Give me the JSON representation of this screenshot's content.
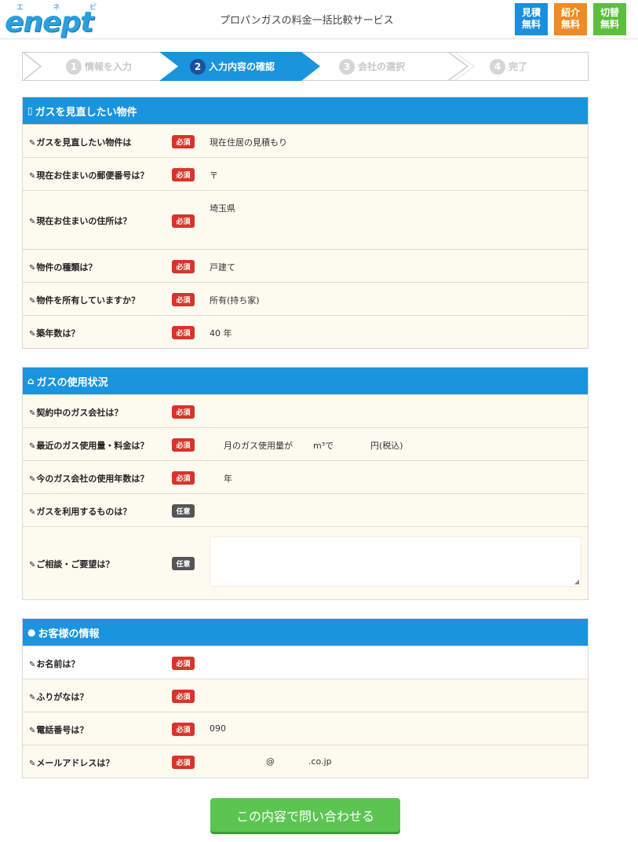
{
  "header": {
    "logo_ruby": [
      "エ",
      "ネ",
      "ピ"
    ],
    "logo_text": "enept",
    "tagline": "プロパンガスの料金一括比較サービス",
    "badges": [
      {
        "line1": "見積",
        "line2": "無料"
      },
      {
        "line1": "紹介",
        "line2": "無料"
      },
      {
        "line1": "切替",
        "line2": "無料"
      }
    ]
  },
  "steps": [
    {
      "num": "1",
      "label": "情報を入力"
    },
    {
      "num": "2",
      "label": "入力内容の確認"
    },
    {
      "num": "3",
      "label": "会社の選択"
    },
    {
      "num": "4",
      "label": "完了"
    }
  ],
  "colors": {
    "accent": "#1a94dd",
    "required": "#d9342b",
    "optional": "#555555",
    "submit": "#5cc552",
    "row_bg": "#fdfaf0",
    "step_active": "#1a94dd",
    "step_active_num": "#1d4f9c"
  },
  "icons": {
    "property": "document-icon",
    "usage": "home-icon",
    "customer": "person-icon",
    "row": "pencil-icon"
  },
  "tags": {
    "required": "必須",
    "optional": "任意"
  },
  "property": {
    "title": "ガスを見直したい物件",
    "rows": [
      {
        "label": "ガスを見直したい物件は",
        "value": "現在住居の見積もり"
      },
      {
        "label": "現在お住まいの郵便番号は？",
        "value": "〒"
      },
      {
        "label": "現在お住まいの住所は？",
        "value": "埼玉県"
      },
      {
        "label": "物件の種類は？",
        "value": "戸建て"
      },
      {
        "label": "物件を所有していますか？",
        "value": "所有(持ち家)"
      },
      {
        "label": "築年数は？",
        "value": "40 年"
      }
    ]
  },
  "usage": {
    "title": "ガスの使用状況",
    "rows": [
      {
        "label": "契約中のガス会社は？",
        "value": ""
      },
      {
        "label": "最近のガス使用量・料金は？",
        "value_parts": [
          "月のガス使用量が",
          "m³で",
          "円(税込)"
        ]
      },
      {
        "label": "今のガス会社の使用年数は？",
        "value": "年"
      },
      {
        "label": "ガスを利用するものは？",
        "value": ""
      },
      {
        "label": "ご相談・ご要望は？",
        "value": ""
      }
    ]
  },
  "customer": {
    "title": "お客様の情報",
    "rows": [
      {
        "label": "お名前は？",
        "value": ""
      },
      {
        "label": "ふりがなは？",
        "value": ""
      },
      {
        "label": "電話番号は？",
        "value": "090"
      },
      {
        "label": "メールアドレスは？",
        "value_parts": [
          "@",
          ".co.jp"
        ]
      }
    ]
  },
  "submit_label": "この内容で問い合わせる"
}
